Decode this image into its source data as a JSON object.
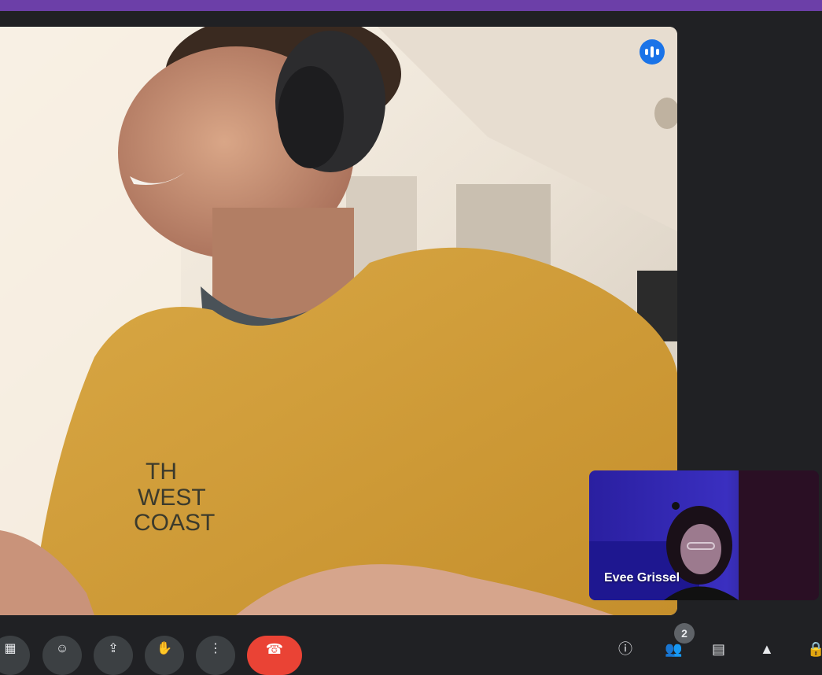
{
  "participants": {
    "main_speaker": {
      "speaking_icon": "audio-wave-icon"
    },
    "self_view": {
      "name": "Evee Grissel"
    }
  },
  "controls": {
    "layout_icon": "▦",
    "emoji_icon": "☺",
    "present_icon": "⇪",
    "raise_hand_icon": "✋",
    "more_icon": "⋮",
    "end_call_icon": "☎",
    "info_icon": "ⓘ",
    "people_icon": "👥",
    "people_count": "2",
    "chat_icon": "▤",
    "activities_icon": "▲",
    "lock_icon": "🔒"
  },
  "colors": {
    "accent_top_bar": "#6c3fa8",
    "background": "#202124",
    "end_call": "#ea4335",
    "speaking_indicator": "#1a73e8"
  }
}
